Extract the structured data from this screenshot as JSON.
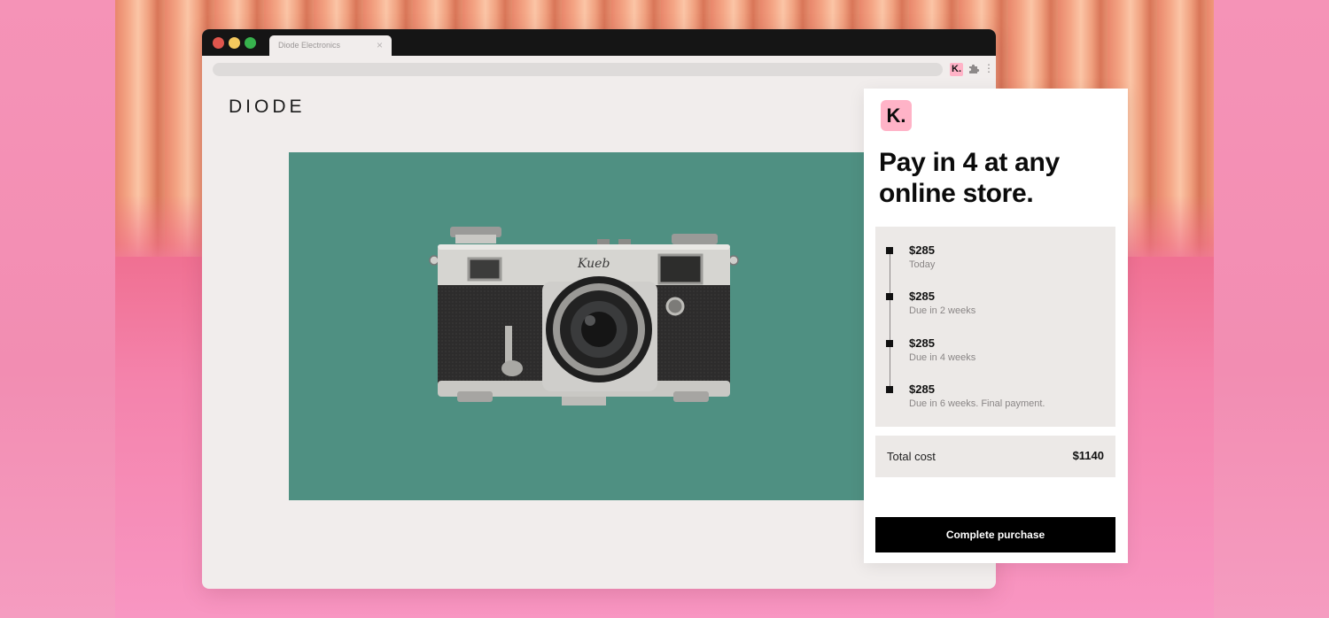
{
  "browser": {
    "tab_title": "Diode Electronics",
    "tab_close_icon": "close-icon",
    "window_controls": [
      "close",
      "minimize",
      "maximize"
    ],
    "extensions": [
      {
        "name": "klarna-extension-icon",
        "label": "K."
      },
      {
        "name": "puzzle-icon"
      },
      {
        "name": "kebab-menu-icon",
        "label": "⋮"
      }
    ]
  },
  "store": {
    "logo": "DIODE"
  },
  "klarna": {
    "logo": "K.",
    "headline": "Pay in 4 at any online store.",
    "schedule": [
      {
        "amount": "$285",
        "desc": "Today"
      },
      {
        "amount": "$285",
        "desc": "Due in 2 weeks"
      },
      {
        "amount": "$285",
        "desc": "Due in 4 weeks"
      },
      {
        "amount": "$285",
        "desc": "Due in 6 weeks. Final payment."
      }
    ],
    "total_label": "Total cost",
    "total_value": "$1140",
    "cta": "Complete purchase"
  },
  "colors": {
    "background": "#f48fb1",
    "klarna_pink": "#ffb3c7",
    "hero_green": "#4f9082",
    "cta_black": "#000000"
  }
}
